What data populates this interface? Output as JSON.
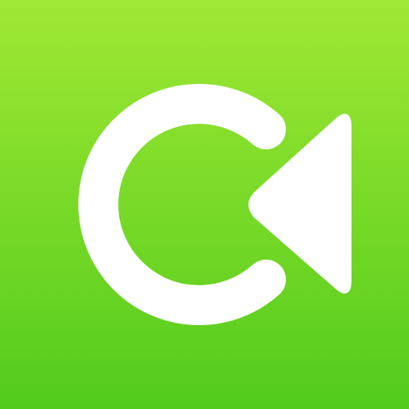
{
  "icon": {
    "name": "app-icon",
    "symbol": "letter-c-with-rewind-triangle",
    "background_top_color": "#a0e834",
    "background_bottom_color": "#52cb1c",
    "foreground_color": "#ffffff"
  }
}
